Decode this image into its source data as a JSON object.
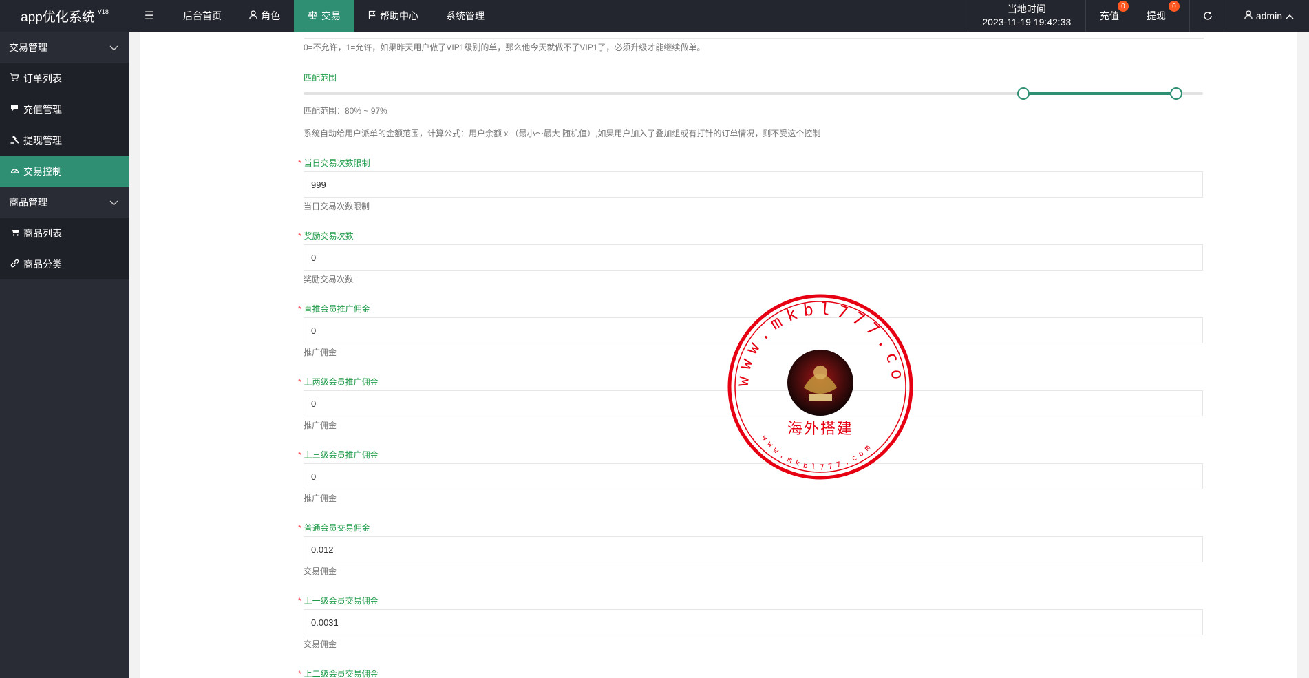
{
  "header": {
    "app_title": "app优化系统",
    "version": "V18",
    "menu_icon": "hamburger-icon",
    "nav": [
      {
        "label": "后台首页",
        "icon": ""
      },
      {
        "label": "角色",
        "icon": "user-icon"
      },
      {
        "label": "交易",
        "icon": "scale-icon"
      },
      {
        "label": "帮助中心",
        "icon": "flag-icon"
      },
      {
        "label": "系统管理",
        "icon": ""
      }
    ],
    "time_label": "当地时间",
    "time_value": "2023-11-19 19:42:33",
    "recharge_label": "充值",
    "recharge_count": "0",
    "withdraw_label": "提现",
    "withdraw_count": "0",
    "user_name": "admin"
  },
  "sidebar": {
    "group1": "交易管理",
    "items1": [
      "订单列表",
      "充值管理",
      "提现管理",
      "交易控制"
    ],
    "group2": "商品管理",
    "items2": [
      "商品列表",
      "商品分类"
    ]
  },
  "form": {
    "top_help": "0=不允许，1=允许，如果昨天用户做了VIP1级别的单，那么他今天就做不了VIP1了，必须升级才能继续做单。",
    "range_label": "匹配范围",
    "range_min": 80,
    "range_max": 97,
    "range_text": "匹配范围：80% ~ 97%",
    "range_help": "系统自动给用户派单的金额范围，计算公式：用户余额 x （最小～最大 随机值）,如果用户加入了叠加组或有打针的订单情况，则不受这个控制",
    "fields": [
      {
        "label": "当日交易次数限制",
        "value": "999",
        "help": "当日交易次数限制"
      },
      {
        "label": "奖励交易次数",
        "value": "0",
        "help": "奖励交易次数"
      },
      {
        "label": "直推会员推广佣金",
        "value": "0",
        "help": "推广佣金"
      },
      {
        "label": "上两级会员推广佣金",
        "value": "0",
        "help": "推广佣金"
      },
      {
        "label": "上三级会员推广佣金",
        "value": "0",
        "help": "推广佣金"
      },
      {
        "label": "普通会员交易佣金",
        "value": "0.012",
        "help": "交易佣金"
      },
      {
        "label": "上一级会员交易佣金",
        "value": "0.0031",
        "help": "交易佣金"
      },
      {
        "label": "上二级会员交易佣金"
      }
    ]
  },
  "stamp": {
    "outer_text": "www.mkbl777.com",
    "center_text": "海外搭建",
    "inner_text": "www.mkbl777.com",
    "color": "#e60012"
  },
  "colors": {
    "accent": "#2f8f72",
    "label_green": "#1e9b48",
    "header_bg": "#23262e",
    "sidebar_bg": "#2a2c35",
    "badge": "#ff5722"
  }
}
